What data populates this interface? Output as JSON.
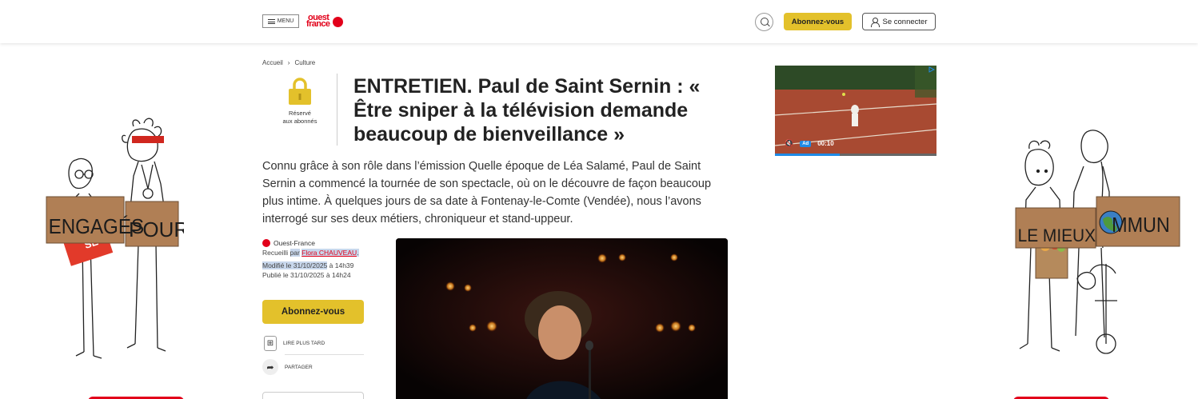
{
  "header": {
    "menu_label": "MENU",
    "logo_line1": "ouest",
    "logo_line2": "france",
    "subscribe_label": "Abonnez-vous",
    "login_label": "Se connecter"
  },
  "breadcrumb": {
    "home": "Accueil",
    "separator": "›",
    "section": "Culture"
  },
  "premium": {
    "label_line1": "Réservé",
    "label_line2": "aux abonnés"
  },
  "article": {
    "title": "ENTRETIEN. Paul de Saint Sernin : « Être sniper à la télévision demande beaucoup de bienveillance »",
    "lede": "Connu grâce à son rôle dans l’émission Quelle époque de Léa Salamé, Paul de Saint Sernin a commencé la tournée de son spectacle, où on le découvre de façon beaucoup plus intime. À quelques jours de sa date à Fontenay-le-Comte (Vendée), nous l’avons interrogé sur ses deux métiers, chroniqueur et stand-uppeur."
  },
  "meta": {
    "source": "Ouest-France",
    "collected_prefix": "Recueilli",
    "collected_by": "par",
    "author": "Flora CHAUVEAU",
    "author_suffix": ".",
    "modified_label": "Modifié le 31/10/2025",
    "modified_time": "à 14h39",
    "published": "Publié le 31/10/2025 à 14h24"
  },
  "sidebar_actions": {
    "subscribe_label": "Abonnez-vous",
    "read_later_label": "LIRE PLUS TARD",
    "share_label": "PARTAGER"
  },
  "video_ad": {
    "ad_badge": "Ad",
    "time": "00:10",
    "progress": 0.4
  },
  "left_illustration": {
    "sign_text_1": "ENGAGÉS",
    "sign_text_2": "POUR",
    "sign_text_3": "SE"
  },
  "right_illustration": {
    "sign_text_1": "LE MIEUX",
    "sign_text_2": "C",
    "sign_text_3": "MMUN"
  },
  "colors": {
    "brand_red": "#e2001a",
    "subscribe_yellow": "#e3c12b",
    "highlight": "#c8d7ec",
    "ad_blue": "#1e8ae6"
  }
}
